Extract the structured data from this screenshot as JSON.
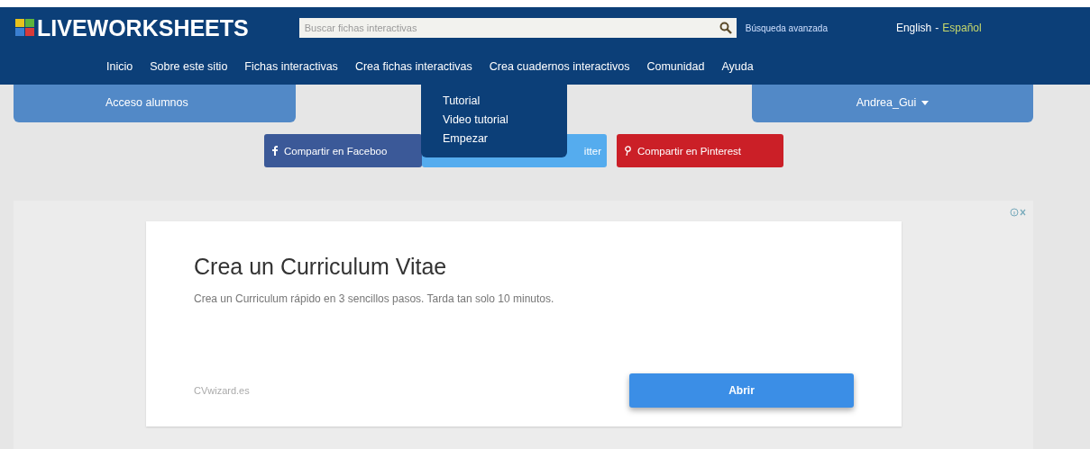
{
  "header": {
    "logo": "LIVEWORKSHEETS",
    "search": {
      "placeholder": "Buscar fichas interactivas"
    },
    "advanced_search": "Búsqueda avanzada",
    "languages": [
      {
        "label": "English",
        "selected": false
      },
      {
        "label": "Español",
        "selected": true
      }
    ],
    "language_separator": "-"
  },
  "nav": [
    {
      "label": "Inicio"
    },
    {
      "label": "Sobre este sitio"
    },
    {
      "label": "Fichas interactivas"
    },
    {
      "label": "Crea fichas interactivas"
    },
    {
      "label": "Crea cuadernos interactivos"
    },
    {
      "label": "Comunidad"
    },
    {
      "label": "Ayuda"
    }
  ],
  "dropdown": [
    "Tutorial",
    "Video tutorial",
    "Empezar"
  ],
  "panels": {
    "left": "Acceso alumnos",
    "user": "Andrea_Gui"
  },
  "share": [
    {
      "kind": "facebook",
      "label": "Compartir en Faceboo"
    },
    {
      "kind": "twitter",
      "label": "itter"
    },
    {
      "kind": "pinterest",
      "label": "Compartir en Pinterest"
    }
  ],
  "ad": {
    "title": "Crea un Curriculum Vitae",
    "text": "Crea un Curriculum rápido en 3 sencillos pasos. Tarda tan solo 10 minutos.",
    "domain": "CVwizard.es",
    "button": "Abrir"
  }
}
